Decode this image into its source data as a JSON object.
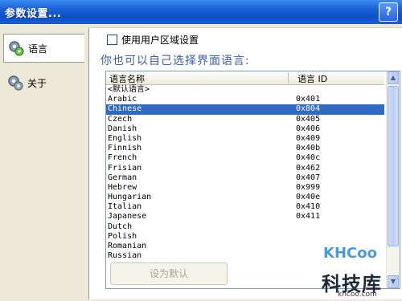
{
  "window": {
    "title": "参数设置...",
    "help": "?"
  },
  "nav": [
    {
      "label": "语言",
      "icon": "gear-icon"
    },
    {
      "label": "关于",
      "icon": "gear-icon"
    }
  ],
  "options": {
    "use_region_label": "使用用户区域设置",
    "use_region_checked": false
  },
  "prompt": "你也可以自己选择界面语言:",
  "list": {
    "headers": {
      "name": "语言名称",
      "id": "语言 ID"
    },
    "rows": [
      {
        "name": "<默认语言>",
        "id": ""
      },
      {
        "name": "Arabic",
        "id": "0x401"
      },
      {
        "name": "Chinese",
        "id": "0x804",
        "selected": true
      },
      {
        "name": "Czech",
        "id": "0x405"
      },
      {
        "name": "Danish",
        "id": "0x406"
      },
      {
        "name": "English",
        "id": "0x409"
      },
      {
        "name": "Finnish",
        "id": "0x40b"
      },
      {
        "name": "French",
        "id": "0x40c"
      },
      {
        "name": "Frisian",
        "id": "0x462"
      },
      {
        "name": "German",
        "id": "0x407"
      },
      {
        "name": "Hebrew",
        "id": "0x999"
      },
      {
        "name": "Hungarian",
        "id": "0x40e"
      },
      {
        "name": "Italian",
        "id": "0x410"
      },
      {
        "name": "Japanese",
        "id": "0x411"
      },
      {
        "name": "Dutch",
        "id": ""
      },
      {
        "name": "Polish",
        "id": ""
      },
      {
        "name": "Romanian",
        "id": ""
      },
      {
        "name": "Russian",
        "id": ""
      }
    ]
  },
  "buttons": {
    "set_default": "设为默认"
  },
  "watermark": {
    "logo": "KHCoo",
    "name": "科技库",
    "url": "khcoo.com"
  },
  "colors": {
    "selection": "#316ac5",
    "title_bar": "#0b4fc9",
    "prompt": "#3a5ea8"
  }
}
